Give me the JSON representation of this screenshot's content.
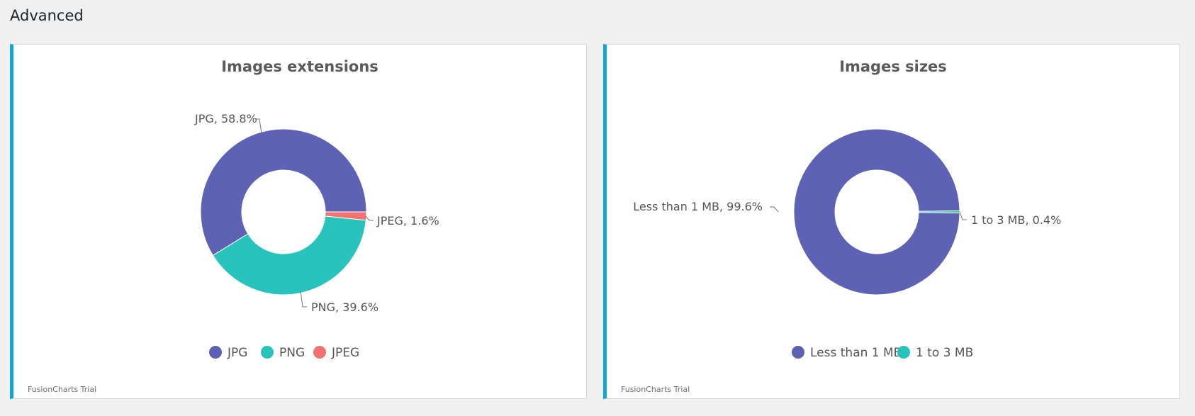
{
  "page": {
    "title": "Advanced"
  },
  "watermark": "FusionCharts Trial",
  "chart_data": [
    {
      "type": "pie",
      "style": "doughnut",
      "title": "Images extensions",
      "categories": [
        "JPG",
        "PNG",
        "JPEG"
      ],
      "values": [
        58.8,
        39.6,
        1.6
      ],
      "labels": [
        "JPG, 58.8%",
        "PNG, 39.6%",
        "JPEG, 1.6%"
      ],
      "colors": [
        "#5d62b5",
        "#29c3be",
        "#f2726f"
      ],
      "legend": [
        "JPG",
        "PNG",
        "JPEG"
      ],
      "legend_position": "bottom"
    },
    {
      "type": "pie",
      "style": "doughnut",
      "title": "Images sizes",
      "categories": [
        "Less than 1 MB",
        "1 to 3 MB"
      ],
      "values": [
        99.6,
        0.4
      ],
      "labels": [
        "Less than 1 MB, 99.6%",
        "1 to 3 MB, 0.4%"
      ],
      "colors": [
        "#5d62b5",
        "#29c3be"
      ],
      "legend": [
        "Less than 1 MB",
        "1 to 3 MB"
      ],
      "legend_position": "bottom"
    }
  ]
}
